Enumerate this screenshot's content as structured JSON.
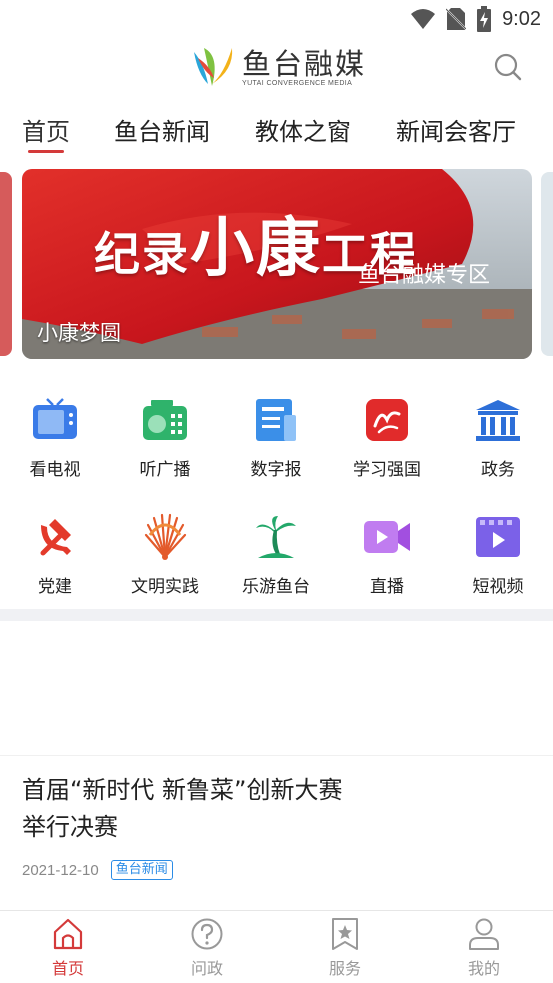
{
  "status_bar": {
    "time": "9:02",
    "icons": [
      "wifi-icon",
      "no-sim-icon",
      "battery-charging-icon"
    ]
  },
  "header": {
    "logo_cn": "鱼台融媒",
    "logo_en": "YUTAI CONVERGENCE MEDIA",
    "search_icon": "search-icon"
  },
  "tabs": [
    {
      "label": "首页",
      "active": true
    },
    {
      "label": "鱼台新闻",
      "active": false
    },
    {
      "label": "教体之窗",
      "active": false
    },
    {
      "label": "新闻会客厅",
      "active": false
    }
  ],
  "banner": {
    "title_a": "纪录",
    "title_b": "小康",
    "title_c": "工程",
    "subtitle": "鱼台融媒专区",
    "caption": "小康梦圆"
  },
  "grid": [
    {
      "label": "看电视",
      "icon": "tv-icon",
      "color": "#3a7be8"
    },
    {
      "label": "听广播",
      "icon": "radio-icon",
      "color": "#2fb36b"
    },
    {
      "label": "数字报",
      "icon": "newspaper-icon",
      "color": "#3b8fe8"
    },
    {
      "label": "学习强国",
      "icon": "xuexi-icon",
      "color": "#e12b2b"
    },
    {
      "label": "政务",
      "icon": "government-icon",
      "color": "#2d6fd8"
    },
    {
      "label": "党建",
      "icon": "party-emblem-icon",
      "color": "#e33a2b"
    },
    {
      "label": "文明实践",
      "icon": "peacock-fan-icon",
      "color": "#e35a2b"
    },
    {
      "label": "乐游鱼台",
      "icon": "palm-tree-icon",
      "color": "#23a86a"
    },
    {
      "label": "直播",
      "icon": "video-camera-icon",
      "color": "#b05ce8"
    },
    {
      "label": "短视频",
      "icon": "film-play-icon",
      "color": "#7b61e8"
    }
  ],
  "article": {
    "title": "首届“新时代 新鲁菜”创新大赛举行决赛",
    "date": "2021-12-10",
    "tag": "鱼台新闻"
  },
  "bottom_nav": [
    {
      "label": "首页",
      "icon": "home-icon",
      "active": true
    },
    {
      "label": "问政",
      "icon": "question-icon",
      "active": false
    },
    {
      "label": "服务",
      "icon": "bookmark-star-icon",
      "active": false
    },
    {
      "label": "我的",
      "icon": "profile-icon",
      "active": false
    }
  ],
  "colors": {
    "accent": "#d43a3a",
    "tag_blue": "#2b8ce6"
  }
}
